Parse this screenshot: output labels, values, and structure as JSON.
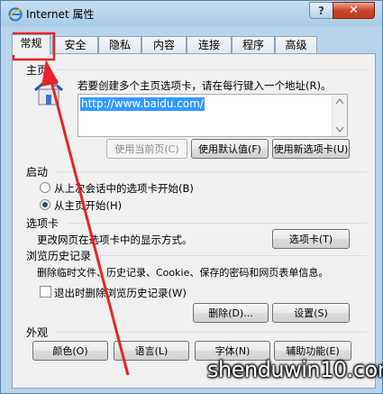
{
  "window": {
    "title": "Internet 属性",
    "help_label": "?",
    "close_label": "✕"
  },
  "tabs": [
    "常规",
    "安全",
    "隐私",
    "内容",
    "连接",
    "程序",
    "高级"
  ],
  "homepage": {
    "title": "主页",
    "instruction": "若要创建多个主页选项卡，请在每行键入一个地址(R)。",
    "url": "http://www.baidu.com/",
    "btn_current": "使用当前页(C)",
    "btn_default": "使用默认值(F)",
    "btn_newtab": "使用新选项卡(U)"
  },
  "startup": {
    "title": "启动",
    "option_last": "从上次会话中的选项卡开始(B)",
    "option_home": "从主页开始(H)",
    "selected": "option_home"
  },
  "tabs_section": {
    "title": "选项卡",
    "desc": "更改网页在选项卡中的显示方式。",
    "btn": "选项卡(T)"
  },
  "history": {
    "title": "浏览历史记录",
    "desc": "删除临时文件、历史记录、Cookie、保存的密码和网页表单信息。",
    "checkbox_label": "退出时删除浏览历史记录(W)",
    "checkbox_checked": false,
    "btn_delete": "删除(D)...",
    "btn_settings": "设置(S)"
  },
  "appearance": {
    "title": "外观",
    "btn_colors": "颜色(O)",
    "btn_languages": "语言(L)",
    "btn_fonts": "字体(N)",
    "btn_accessibility": "辅助功能(E)"
  },
  "watermark": "shenduwin10.com",
  "colors": {
    "annotation_red": "#e8232b",
    "selection_blue": "#3399ff",
    "close_red": "#c74a2c"
  }
}
